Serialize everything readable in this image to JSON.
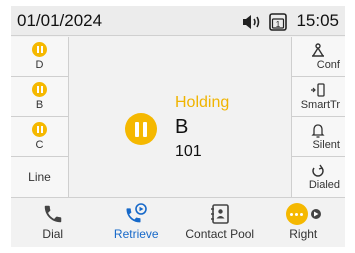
{
  "status_bar": {
    "date": "01/01/2024",
    "time": "15:05",
    "line_indicator": "1"
  },
  "left_keys": [
    {
      "label": "D",
      "icon": "hold-icon"
    },
    {
      "label": "B",
      "icon": "hold-icon"
    },
    {
      "label": "C",
      "icon": "hold-icon"
    },
    {
      "label": "Line",
      "icon": ""
    }
  ],
  "right_keys": [
    {
      "label": "Conf",
      "icon": "conference-icon"
    },
    {
      "label": "SmartTr",
      "icon": "smart-transfer-icon"
    },
    {
      "label": "Silent",
      "icon": "bell-icon"
    },
    {
      "label": "Dialed",
      "icon": "redial-icon"
    }
  ],
  "call": {
    "state": "Holding",
    "name": "B",
    "number": "101"
  },
  "softkeys": [
    {
      "label": "Dial",
      "icon": "phone-icon"
    },
    {
      "label": "Retrieve",
      "icon": "retrieve-icon"
    },
    {
      "label": "Contact Pool",
      "icon": "contact-book-icon"
    },
    {
      "label": "Right",
      "icon": "more-icon"
    }
  ],
  "colors": {
    "hold_accent": "#f5b800",
    "active_blue": "#1769c9"
  }
}
